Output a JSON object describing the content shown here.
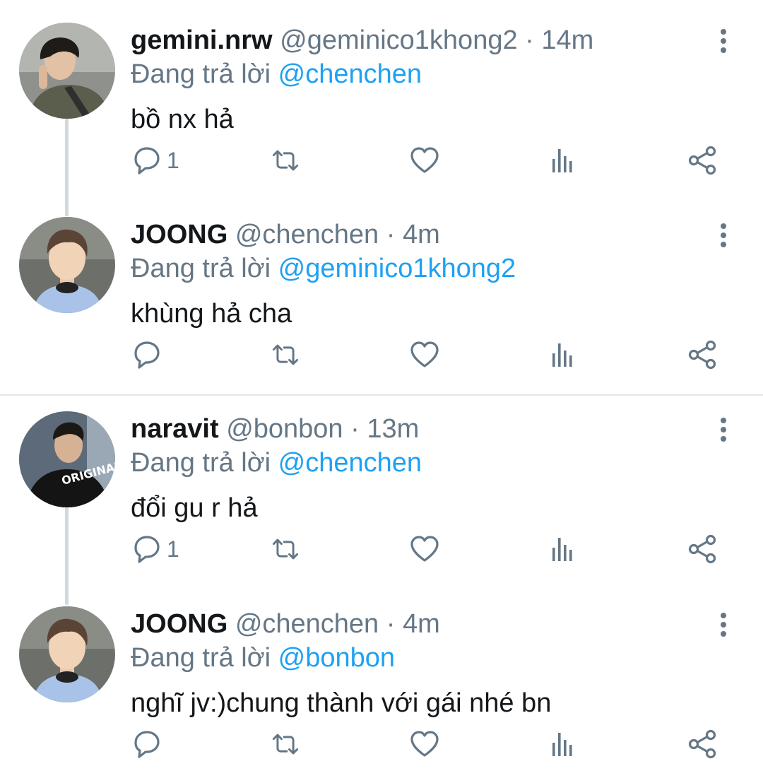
{
  "tweets": [
    {
      "name": "gemini.nrw",
      "handle": "@geminico1khong2",
      "separator": "·",
      "time": "14m",
      "reply_prefix": "Đang trả lời",
      "reply_to": "@chenchen",
      "text": "bồ nx hả",
      "reply_count": "1"
    },
    {
      "name": "JOONG",
      "handle": "@chenchen",
      "separator": "·",
      "time": "4m",
      "reply_prefix": "Đang trả lời",
      "reply_to": "@geminico1khong2",
      "text": "khùng hả cha",
      "reply_count": ""
    },
    {
      "name": "naravit",
      "handle": "@bonbon",
      "separator": "·",
      "time": "13m",
      "reply_prefix": "Đang trả lời",
      "reply_to": "@chenchen",
      "text": "đổi gu r hả",
      "reply_count": "1"
    },
    {
      "name": "JOONG",
      "handle": "@chenchen",
      "separator": "·",
      "time": "4m",
      "reply_prefix": "Đang trả lời",
      "reply_to": "@bonbon",
      "text": "nghĩ jv:)chung thành với gái nhé bn",
      "reply_count": ""
    }
  ],
  "avatar_print_text": "ORIGINAL",
  "icons": [
    "reply-icon",
    "retweet-icon",
    "like-icon",
    "analytics-icon",
    "share-icon",
    "more-options-icon"
  ],
  "colors": {
    "text": "#14171a",
    "secondary": "#657786",
    "link": "#1da1f2",
    "thread_line": "#cfd9de",
    "divider": "#e1e8ed"
  }
}
